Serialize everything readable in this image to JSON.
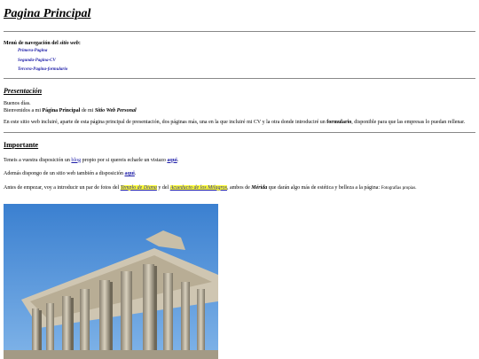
{
  "page": {
    "title": "Pagina Principal"
  },
  "nav": {
    "title_pre": "Menú de navegación del ",
    "title_em": "sitio web",
    "title_post": ":",
    "items": [
      "Primera-Pagina",
      "Segunda-Pagina-CV",
      "Tercera-Pagina-formulario"
    ]
  },
  "presentacion": {
    "heading": "Presentación",
    "greeting": "Buenos días.",
    "welcome_pre": "Bienvenidos a mi ",
    "welcome_bold": "Página Principal",
    "welcome_mid": " de mi ",
    "welcome_em": "Sitio Web Personal",
    "intro_pre": "En este sitio web incluiré, aparte de esta página principal de presentación, dos páginas más, una en la que incluiré mi CV y la otra donde introduciré un ",
    "intro_bold": "formulario",
    "intro_post": ", disponible para que las empresas lo puedan rellenar."
  },
  "importante": {
    "heading": "Importante",
    "blog_pre": "Teneis a vuestra disposición un ",
    "blog_link": "blog",
    "blog_mid": " propio por si quereis echarle un vistazo ",
    "blog_here": "aqui",
    "blog_post": ".",
    "site_pre": "Además dispongo de un sitio web también a disposición ",
    "site_here": "aqui",
    "site_post": ".",
    "before_pre": "Antes de empezar, voy a introducir un par de fotos del ",
    "templo": "Templo de Diana",
    "y_del": " y del ",
    "acueducto": "Acueducto de los Milagros",
    "ambos": ", ambos de ",
    "merida": "Mérida",
    "darian": " que darán algo más de estética y belleza a la página: ",
    "fotos": "Fotografías propias."
  },
  "colors": {
    "link": "#1a1aa6",
    "highlight": "#ffff33",
    "sky": "#4d8fd6"
  }
}
